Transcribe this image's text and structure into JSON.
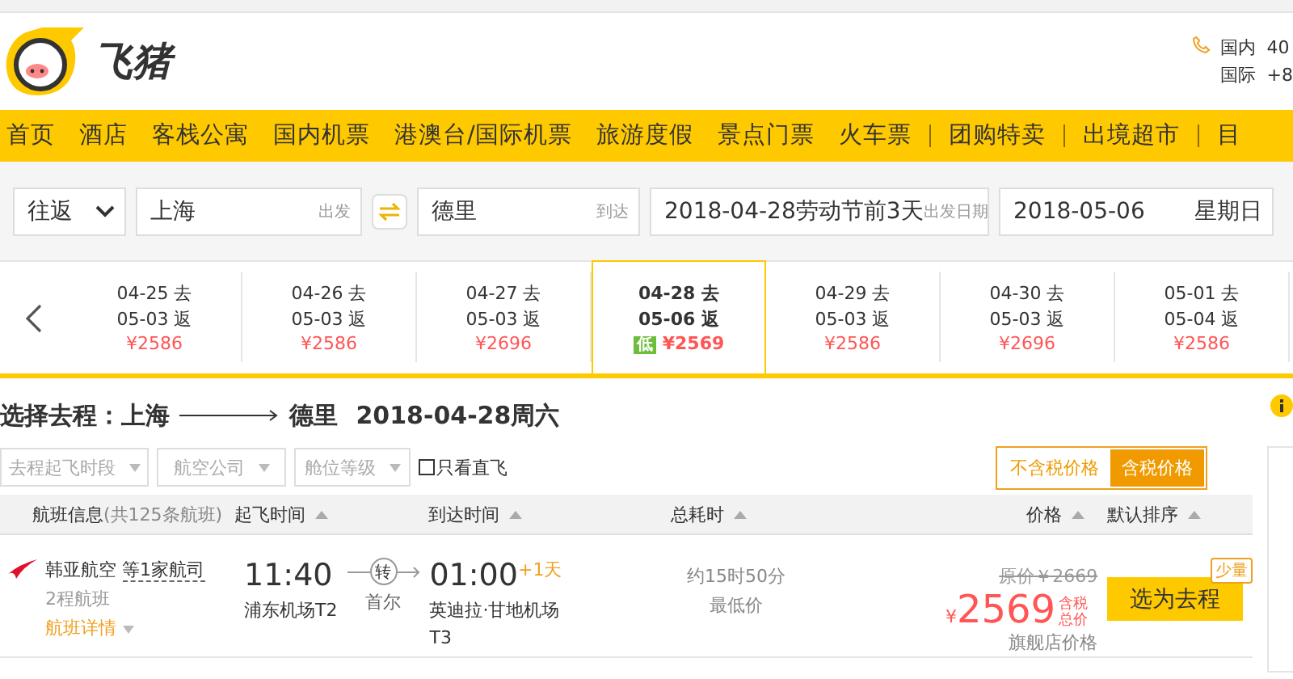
{
  "header": {
    "logo_text": "飞猪",
    "phone": [
      {
        "label": "国内",
        "number": "40"
      },
      {
        "label": "国际",
        "number": "+8"
      }
    ]
  },
  "nav": [
    {
      "label": "首页",
      "separated": false
    },
    {
      "label": "酒店",
      "separated": false
    },
    {
      "label": "客栈公寓",
      "separated": false
    },
    {
      "label": "国内机票",
      "separated": false
    },
    {
      "label": "港澳台/国际机票",
      "separated": false
    },
    {
      "label": "旅游度假",
      "separated": false
    },
    {
      "label": "景点门票",
      "separated": false
    },
    {
      "label": "火车票",
      "separated": false
    },
    {
      "label": "团购特卖",
      "separated": true
    },
    {
      "label": "出境超市",
      "separated": true
    },
    {
      "label": "目",
      "separated": true
    }
  ],
  "search": {
    "trip_type": "往返",
    "from": {
      "value": "上海",
      "hint": "出发"
    },
    "to": {
      "value": "德里",
      "hint": "到达"
    },
    "depart": {
      "value": "2018-04-28劳动节前3天",
      "hint": "出发日期"
    },
    "return": {
      "value": "2018-05-06",
      "weekday": "星期日"
    }
  },
  "dates": [
    {
      "depart": "04-25 去",
      "return": "05-03 返",
      "price": "¥2586",
      "selected": false
    },
    {
      "depart": "04-26 去",
      "return": "05-03 返",
      "price": "¥2586",
      "selected": false
    },
    {
      "depart": "04-27 去",
      "return": "05-03 返",
      "price": "¥2696",
      "selected": false
    },
    {
      "depart": "04-28 去",
      "return": "05-06 返",
      "price": "¥2569",
      "selected": true,
      "badge": "低"
    },
    {
      "depart": "04-29 去",
      "return": "05-03 返",
      "price": "¥2586",
      "selected": false
    },
    {
      "depart": "04-30 去",
      "return": "05-03 返",
      "price": "¥2696",
      "selected": false
    },
    {
      "depart": "05-01 去",
      "return": "05-04 返",
      "price": "¥2586",
      "selected": false
    }
  ],
  "route": {
    "label": "选择去程：",
    "from": "上海",
    "to": "德里",
    "date": "2018-04-28周六"
  },
  "filters": [
    {
      "label": "去程起飞时段"
    },
    {
      "label": "航空公司"
    },
    {
      "label": "舱位等级"
    }
  ],
  "direct_only": {
    "label": "只看直飞",
    "checked": false
  },
  "tax_toggle": [
    {
      "label": "不含税价格",
      "selected": false
    },
    {
      "label": "含税价格",
      "selected": true
    }
  ],
  "columns": [
    {
      "label": "航班信息",
      "note": "(共125条航班)",
      "sortable": false
    },
    {
      "label": "起飞时间",
      "sortable": true
    },
    {
      "label": "到达时间",
      "sortable": true
    },
    {
      "label": "总耗时",
      "sortable": true
    },
    {
      "label": "价格",
      "sortable": true
    },
    {
      "label": "默认排序",
      "sortable": true
    }
  ],
  "flights": [
    {
      "airline": "韩亚航空",
      "partner": "等1家航司",
      "type": "2程航班",
      "details": "航班详情",
      "depart_time": "11:40",
      "depart_airport": "浦东机场T2",
      "stop_badge": "转",
      "stop_city": "首尔",
      "arrive_time": "01:00",
      "day_offset": "+1天",
      "arrive_airport": "英迪拉·甘地机场",
      "arrive_terminal": "T3",
      "duration": "约15时50分",
      "duration_note": "最低价",
      "original_price": "原价￥2669",
      "currency": "¥",
      "price": "2569",
      "price_note": "含税总价",
      "price_source": "旗舰店价格",
      "stock_tag": "少量",
      "action": "选为去程"
    }
  ]
}
